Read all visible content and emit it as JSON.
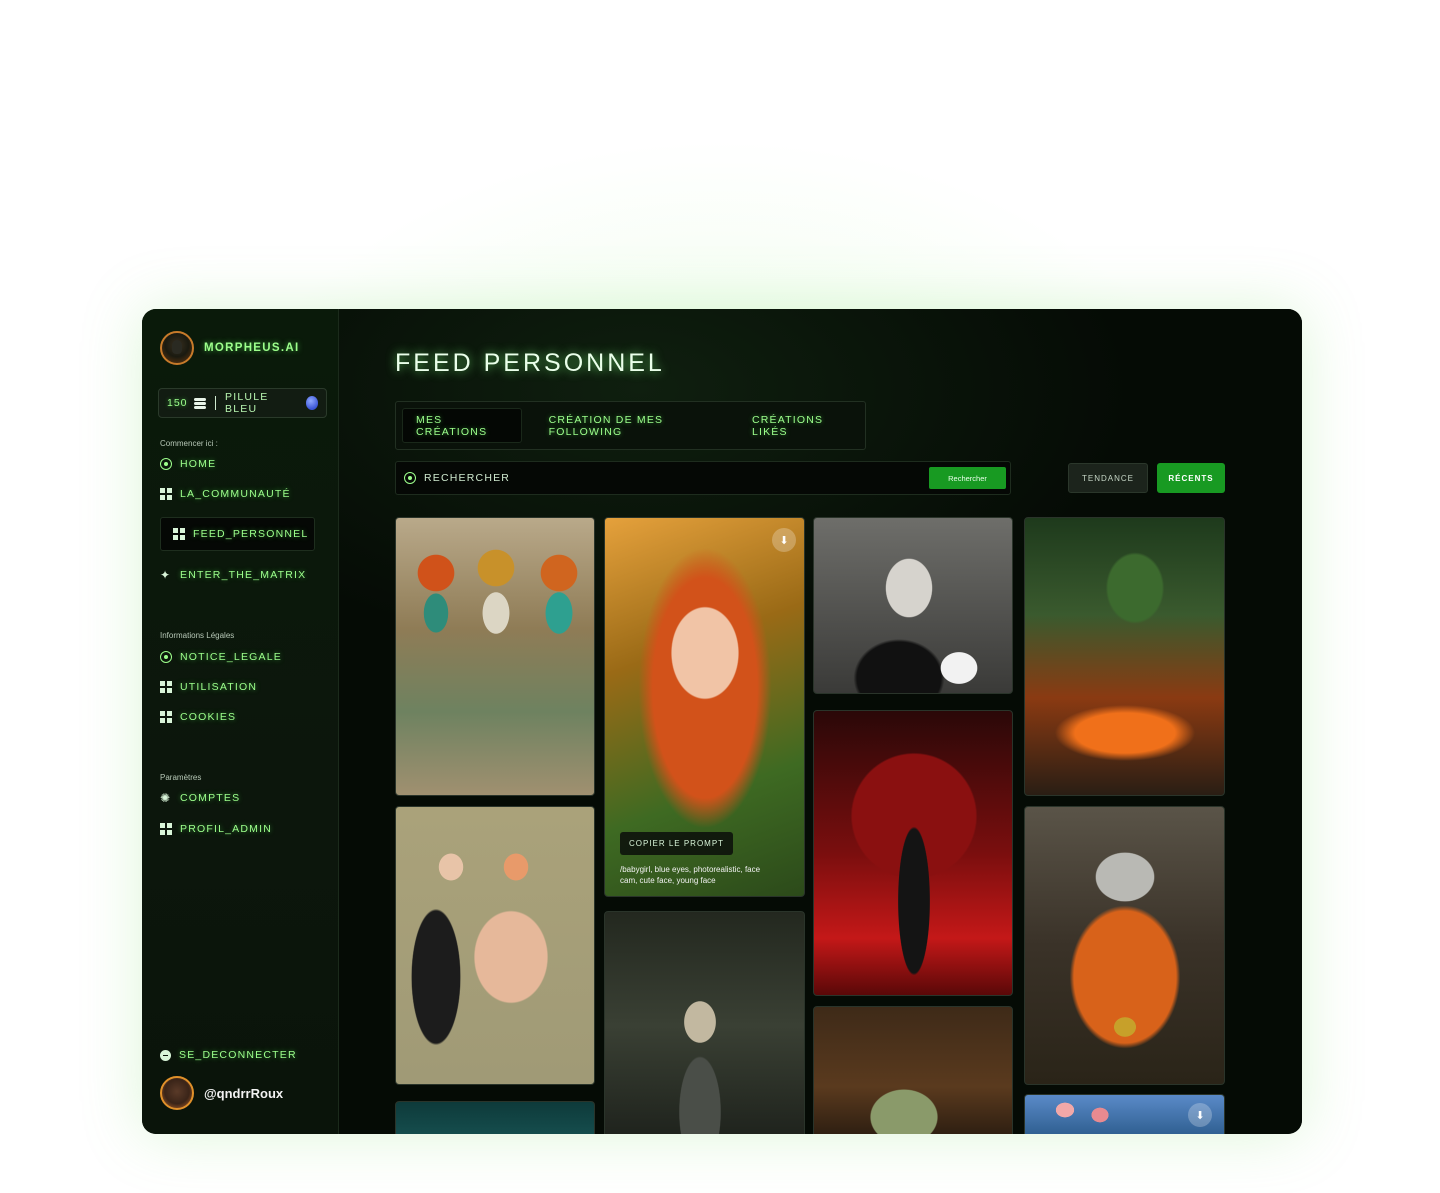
{
  "brand": {
    "name": "MORPHEUS.AI"
  },
  "credits": {
    "amount": "150",
    "plan": "PILULE BLEU"
  },
  "sidebar": {
    "sections": [
      {
        "label": "Commencer ici :"
      },
      {
        "label": "Informations Légales"
      },
      {
        "label": "Paramètres"
      }
    ],
    "items": [
      {
        "label": "HOME",
        "icon": "target-icon"
      },
      {
        "label": "LA_COMMUNAUTÉ",
        "icon": "grid-icon"
      },
      {
        "label": "FEED_PERSONNEL",
        "icon": "grid-icon",
        "active": true
      },
      {
        "label": "ENTER_THE_MATRIX",
        "icon": "sparkle-icon"
      },
      {
        "label": "NOTICE_LEGALE",
        "icon": "target-icon"
      },
      {
        "label": "UTILISATION",
        "icon": "grid-icon"
      },
      {
        "label": "COOKIES",
        "icon": "grid-icon"
      },
      {
        "label": "COMPTES",
        "icon": "gear-icon"
      },
      {
        "label": "PROFIL_ADMIN",
        "icon": "grid-icon"
      },
      {
        "label": "SE_DECONNECTER",
        "icon": "logout-icon"
      }
    ]
  },
  "user": {
    "handle": "@qndrrRoux"
  },
  "main": {
    "title": "FEED PERSONNEL",
    "tabs": [
      {
        "label": "MES CRÉATIONS",
        "active": true
      },
      {
        "label": "CRÉATION DE MES FOLLOWING"
      },
      {
        "label": "CRÉATIONS LIKÉS"
      }
    ],
    "search": {
      "placeholder": "RECHERCHER",
      "button": "Rechercher"
    },
    "filters": {
      "trending": "TENDANCE",
      "recent": "RÉCENTS"
    },
    "hover_card": {
      "copy_label": "COPIER LE PROMPT",
      "prompt": "/babygirl, blue eyes, photorealistic, face cam, cute face, young face"
    }
  },
  "colors": {
    "accent_green": "#9dff8c",
    "button_green": "#189a22",
    "app_bg": "#050b05"
  }
}
